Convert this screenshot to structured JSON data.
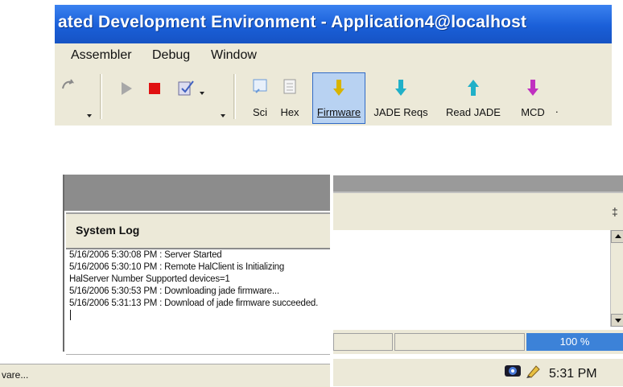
{
  "window": {
    "title": "ated Development Environment - Application4@localhost"
  },
  "menu": {
    "items": [
      "Assembler",
      "Debug",
      "Window"
    ]
  },
  "toolbar": {
    "buttons": [
      {
        "label": "Sci",
        "icon": "sci-icon",
        "color": "#6a9ad8"
      },
      {
        "label": "Hex",
        "icon": "hex-icon",
        "color": "#9a9a9a"
      },
      {
        "label": "Firmware",
        "icon": "arrow-down-icon",
        "color": "#d8b400",
        "active": true
      },
      {
        "label": "JADE Reqs",
        "icon": "arrow-down-icon",
        "color": "#20b0c8"
      },
      {
        "label": "Read JADE",
        "icon": "arrow-up-icon",
        "color": "#20b0c8"
      },
      {
        "label": "MCD",
        "icon": "arrow-down-icon",
        "color": "#c030c0"
      }
    ],
    "overflow": "."
  },
  "system_log": {
    "title": "System Log",
    "lines": [
      "5/16/2006 5:30:08 PM : Server Started",
      "5/16/2006 5:30:10 PM : Remote HalClient is Initializing",
      "HalServer Number Supported devices=1",
      "5/16/2006 5:30:53 PM : Downloading jade firmware...",
      "5/16/2006 5:31:13 PM : Download of jade firmware succeeded."
    ]
  },
  "status_bar": {
    "left_text": "vare...",
    "progress": "100 %"
  },
  "tray": {
    "clock": "5:31 PM"
  },
  "colors": {
    "titlebar": "#1a5fd8",
    "progress": "#3c82d8",
    "stop_red": "#e01010"
  }
}
